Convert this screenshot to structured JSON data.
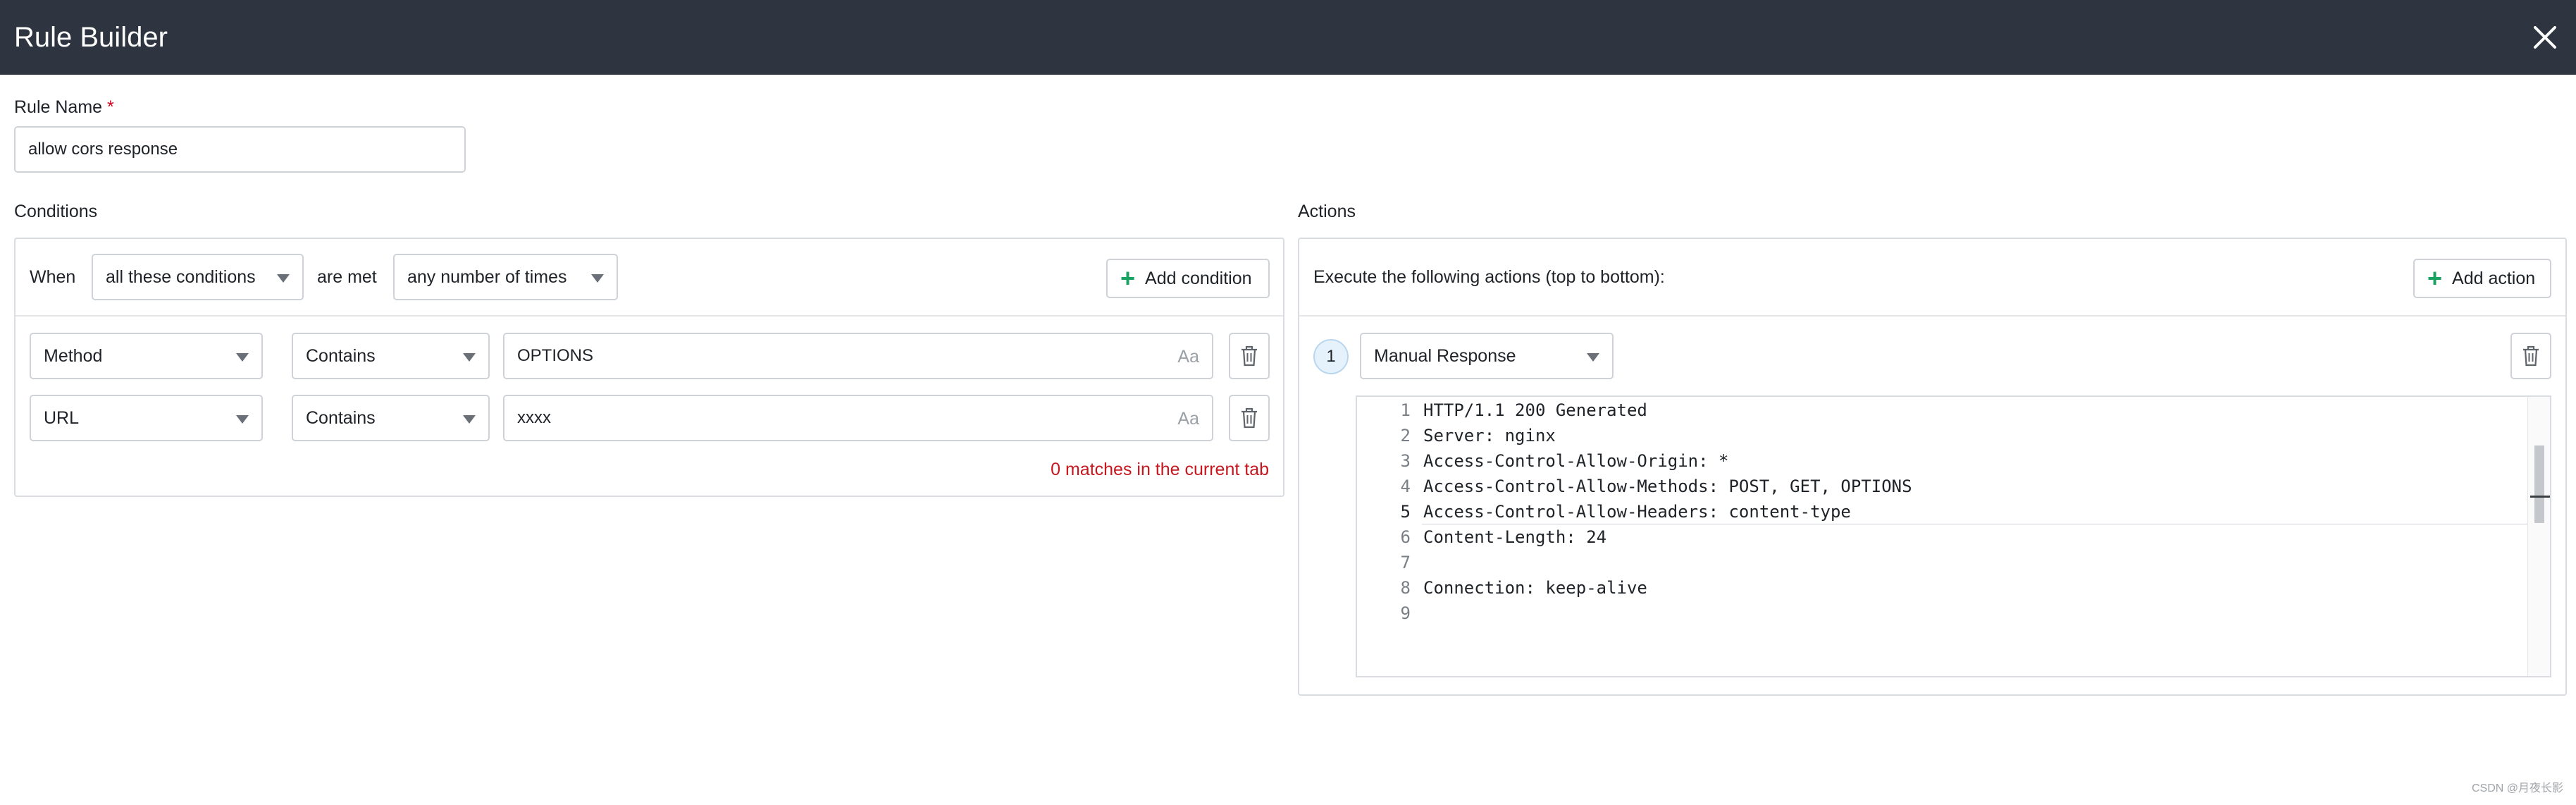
{
  "window": {
    "title": "Rule Builder"
  },
  "rule_name": {
    "label": "Rule Name",
    "required_mark": "*",
    "value": "allow cors response"
  },
  "conditions": {
    "section_label": "Conditions",
    "when_label": "When",
    "mode_select": "all these conditions",
    "are_met_label": "are met",
    "frequency_select": "any number of times",
    "add_button": "Add condition",
    "rows": [
      {
        "field": "Method",
        "operator": "Contains",
        "value": "OPTIONS",
        "case_toggle": "Aa"
      },
      {
        "field": "URL",
        "operator": "Contains",
        "value": "xxxx",
        "case_toggle": "Aa"
      }
    ],
    "match_status": "0 matches in the current tab"
  },
  "actions": {
    "section_label": "Actions",
    "description": "Execute the following actions (top to bottom):",
    "add_button": "Add action",
    "items": [
      {
        "step": "1",
        "type": "Manual Response",
        "editor": {
          "active_line": 5,
          "lines": [
            {
              "n": "1",
              "text": "HTTP/1.1 200 Generated"
            },
            {
              "n": "2",
              "text": "Server: nginx"
            },
            {
              "n": "3",
              "text": "Access-Control-Allow-Origin: *"
            },
            {
              "n": "4",
              "text": "Access-Control-Allow-Methods: POST, GET, OPTIONS"
            },
            {
              "n": "5",
              "text": "Access-Control-Allow-Headers: content-type"
            },
            {
              "n": "6",
              "text": "Content-Length: 24"
            },
            {
              "n": "7",
              "text": ""
            },
            {
              "n": "8",
              "text": "Connection: keep-alive"
            },
            {
              "n": "9",
              "text": ""
            }
          ]
        }
      }
    ]
  },
  "watermark": "CSDN @月夜长影",
  "colors": {
    "titlebar": "#2e3440",
    "add_plus": "#1aa260",
    "match_status": "#c7161d",
    "required": "#d0021b"
  },
  "icons": {
    "close": "close-icon",
    "delete": "trash-icon",
    "add": "plus-icon",
    "dropdown": "caret-down-icon"
  }
}
